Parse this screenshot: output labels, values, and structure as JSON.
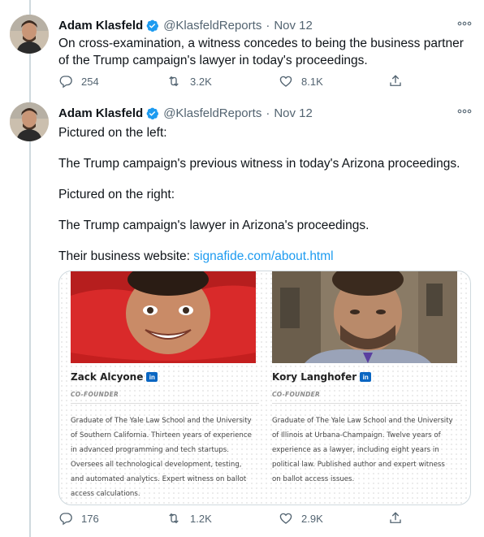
{
  "colors": {
    "accent": "#1d9bf0",
    "verified": "#1d9bf0",
    "linkedin": "#0a66c2",
    "muted": "#536471"
  },
  "tweets": [
    {
      "author": {
        "name": "Adam Klasfeld",
        "handle": "@KlasfeldReports",
        "verified_icon": "verified-badge-icon"
      },
      "separator": "·",
      "date": "Nov 12",
      "text": [
        "On cross-examination, a witness concedes to being the business partner",
        "of the Trump campaign's lawyer in today's proceedings."
      ],
      "stats": {
        "replies": "254",
        "retweets": "3.2K",
        "likes": "8.1K"
      }
    },
    {
      "author": {
        "name": "Adam Klasfeld",
        "handle": "@KlasfeldReports",
        "verified_icon": "verified-badge-icon"
      },
      "separator": "·",
      "date": "Nov 12",
      "paragraphs": [
        "Pictured on the left:",
        "The Trump campaign's previous witness in today's Arizona proceedings.",
        "Pictured on the right:",
        "The Trump campaign's lawyer in Arizona's proceedings."
      ],
      "website_prefix": "Their business website: ",
      "website_link": "signafide.com/about.html",
      "card": {
        "people": [
          {
            "name": "Zack Alcyone",
            "badge": "in",
            "role": "CO-FOUNDER",
            "bio": [
              "Graduate of The Yale Law School and the University",
              "of Southern California. Thirteen years of experience",
              "in advanced programming and tech startups.",
              "Oversees all technological development, testing,",
              "and automated analytics. Expert witness on ballot",
              "access calculations."
            ]
          },
          {
            "name": "Kory Langhofer",
            "badge": "in",
            "role": "CO-FOUNDER",
            "bio": [
              "Graduate of The Yale Law School and the University",
              "of Illinois at Urbana-Champaign. Twelve years of",
              "experience as a lawyer, including eight years in",
              "political law. Published author and expert witness",
              "on ballot access issues."
            ]
          }
        ]
      },
      "stats": {
        "replies": "176",
        "retweets": "1.2K",
        "likes": "2.9K"
      }
    }
  ]
}
